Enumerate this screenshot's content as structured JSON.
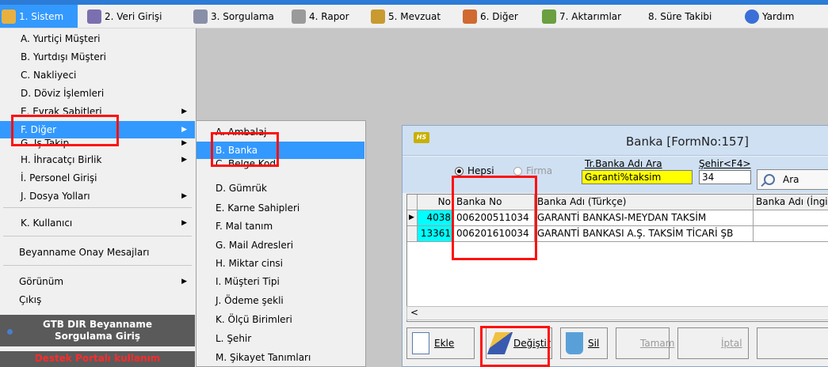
{
  "menubar": {
    "items": [
      {
        "label": "1. Sistem"
      },
      {
        "label": "2. Veri Girişi"
      },
      {
        "label": "3. Sorgulama"
      },
      {
        "label": "4. Rapor"
      },
      {
        "label": "5. Mevzuat"
      },
      {
        "label": "6. Diğer"
      },
      {
        "label": "7. Aktarımlar"
      },
      {
        "label": "8. Süre Takibi"
      },
      {
        "label": "Yardım"
      }
    ]
  },
  "main_menu": {
    "items": [
      {
        "label": "A.  Yurtiçi Müşteri"
      },
      {
        "label": "B.  Yurtdışı Müşteri"
      },
      {
        "label": "C.  Nakliyeci"
      },
      {
        "label": "D.  Döviz İşlemleri"
      },
      {
        "label": "E.  Evrak Sabitleri"
      },
      {
        "label": "F.  Diğer"
      },
      {
        "label": "G.  İş Takip"
      },
      {
        "label": "H.  İhracatçı Birlik"
      },
      {
        "label": "İ.   Personel Girişi"
      },
      {
        "label": "J.  Dosya Yolları"
      },
      {
        "label": "K.  Kullanıcı"
      },
      {
        "label": "Beyanname Onay Mesajları"
      },
      {
        "label": "Görünüm"
      },
      {
        "label": "Çıkış"
      }
    ],
    "gtb_line1": "GTB DIR Beyanname",
    "gtb_line2": "Sorgulama Giriş",
    "destek": "Destek Portalı kullanım"
  },
  "sub_menu": {
    "items": [
      {
        "label": "A.  Ambalaj"
      },
      {
        "label": "B.  Banka"
      },
      {
        "label": "C.  Belge Kod"
      },
      {
        "label": "D.  Gümrük"
      },
      {
        "label": "E.  Karne Sahipleri"
      },
      {
        "label": "F.  Mal tanım"
      },
      {
        "label": "G.  Mail Adresleri"
      },
      {
        "label": "H.  Miktar cinsi"
      },
      {
        "label": "I.  Müşteri Tipi"
      },
      {
        "label": "J.  Ödeme şekli"
      },
      {
        "label": "K.  Ölçü Birimleri"
      },
      {
        "label": "L.  Şehir"
      },
      {
        "label": "M.  Şikayet Tanımları"
      }
    ]
  },
  "banka_form": {
    "title": "Banka [FormNo:157]",
    "radio_all": "Hepsi",
    "radio_firma": "Firma",
    "search_label": "Tr.Banka Adı Ara",
    "search_value": "Garanti%taksim",
    "sehir_label": "Şehir<F4>",
    "sehir_value": "34",
    "ara_label": "Ara",
    "columns": [
      "No",
      "Banka No",
      "Banka Adı (Türkçe)",
      "Banka Adı (İngiliz"
    ],
    "rows": [
      {
        "no": "4038",
        "banka_no": "006200511034",
        "banka_adi": "GARANTİ BANKASI-MEYDAN TAKSİM",
        "banka_adi_en": ""
      },
      {
        "no": "13361",
        "banka_no": "006201610034",
        "banka_adi": "GARANTİ BANKASI A.Ş. TAKSİM TİCARİ ŞB",
        "banka_adi_en": ""
      }
    ],
    "buttons": {
      "ekle": "Ekle",
      "degistir": "Değiştir",
      "sil": "Sil",
      "tamam": "Tamam",
      "iptal": "İptal"
    }
  },
  "colors": {
    "highlight": "#3399ff",
    "annotation_red": "#ff1010",
    "search_bg": "#ffff00",
    "row_no_bg": "#00ffff"
  }
}
